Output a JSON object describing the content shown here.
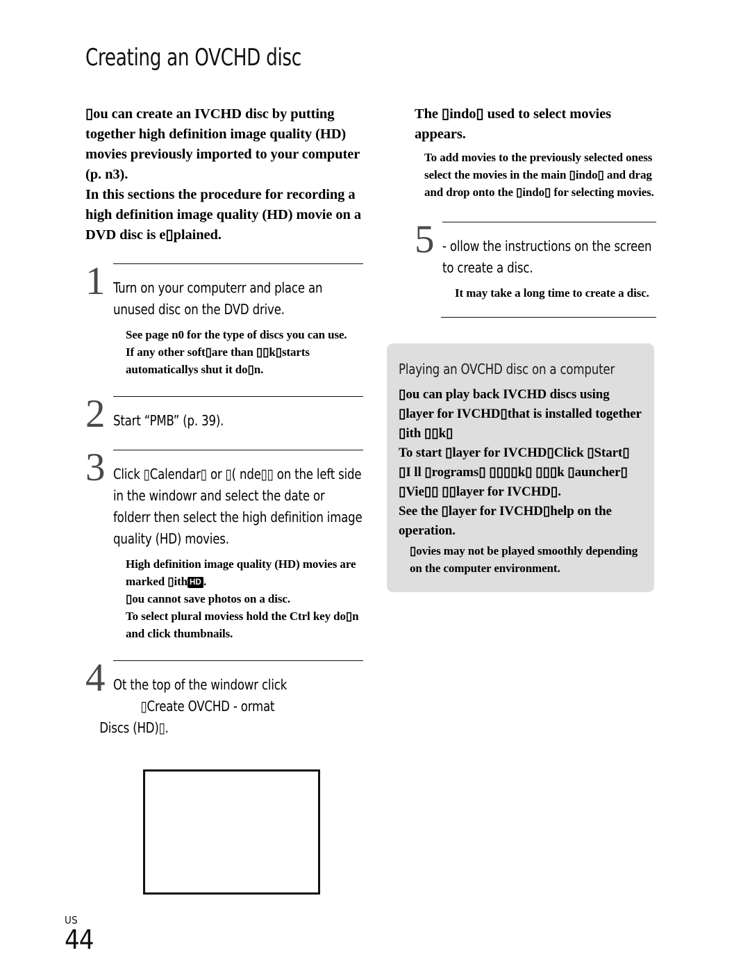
{
  "page": {
    "title": "Creating an OVCHD disc",
    "footer_region": "US",
    "footer_page_number": "44"
  },
  "intro": {
    "paragraph_1": "▯ou can create an IVCHD disc by putting together high definition image quality (HD) movies previously imported to your computer (p. n3).",
    "paragraph_2": "In this sections the procedure for recording a high definition image quality (HD) movie on a DVD disc is e▯plained."
  },
  "steps": [
    {
      "number": "1",
      "text": "Turn on your computerr and place an unused disc on the DVD drive.",
      "notes": [
        "See page n0 for the type of discs you can use.",
        "If any other soft▯are than ▯▯k▯starts automaticallys shut it do▯n."
      ]
    },
    {
      "number": "2",
      "text": "Start “PMB” (p. 39).",
      "notes": []
    },
    {
      "number": "3",
      "text": "Click ▯Calendar▯ or ▯( nde▯▯ on the left side in the windowr  and select the date or folderr  then select the high definition image quality (HD) movies.",
      "notes": [
        "High definition image quality (HD) movies are marked ▯ith",
        "▯ou cannot save photos on a disc.",
        "To select plural moviess  hold the Ctrl key do▯n and click thumbnails."
      ],
      "note_badge": "HD",
      "note_badge_tail": "."
    },
    {
      "number": "4",
      "text_line_1": "Ot the top of the windowr  click",
      "text_line_2": "▯Create OVCHD - ormat",
      "text_line_3": "Discs (HD)▯.",
      "notes": []
    },
    {
      "number": "5",
      "text": "- ollow the instructions on the screen to create a disc.",
      "notes": [
        "It may take a long time to create a disc."
      ]
    }
  ],
  "right_column": {
    "result_heading": "The ▯indo▯ used to select movies appears.",
    "result_note": "To add movies to the previously selected oness  select the movies in the main ▯indo▯ and drag and drop onto the ▯indo▯ for selecting movies."
  },
  "sidebar_box": {
    "title": "Playing an OVCHD disc on a computer",
    "body_1": "▯ou can play back IVCHD discs using ▯layer for IVCHD▯that is installed together ▯ith ▯▯k▯",
    "body_2": "To start ▯layer for IVCHD▯Click ▯Start▯   ▯I ll ▯rograms▯    ▯▯▯▯k▯  ▯▯▯k ▯auncher▯    ▯Vie▯▯   ▯▯layer for IVCHD▯.",
    "body_3": "See the ▯layer for IVCHD▯help on the operation.",
    "note": "▯ovies may not be played smoothly depending on the computer environment.",
    "background_color": "#dedede"
  },
  "figure": {
    "caption": ""
  }
}
